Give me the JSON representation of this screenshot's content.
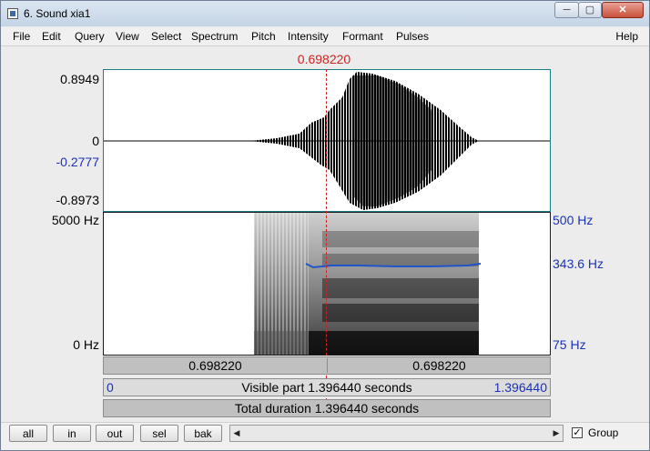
{
  "window": {
    "title": "6. Sound xia1"
  },
  "menu": {
    "items": [
      "File",
      "Edit",
      "Query",
      "View",
      "Select",
      "Spectrum",
      "Pitch",
      "Intensity",
      "Formant",
      "Pulses"
    ],
    "help": "Help"
  },
  "cursor": {
    "time_label": "0.698220",
    "time": 0.69822
  },
  "waveform": {
    "y_max": "0.8949",
    "y_zero": "0",
    "y_cursor": "-0.2777",
    "y_min": "-0.8973"
  },
  "spectrogram": {
    "freq_max": "5000 Hz",
    "freq_min": "0 Hz"
  },
  "pitch": {
    "top": "500 Hz",
    "value": "343.6 Hz",
    "bottom": "75 Hz"
  },
  "bars": {
    "left_segment": "0.698220",
    "right_segment": "0.698220",
    "visible_start": "0",
    "visible_text": "Visible part 1.396440 seconds",
    "visible_end": "1.396440",
    "total_text": "Total duration 1.396440 seconds"
  },
  "nav": {
    "all": "all",
    "in": "in",
    "out": "out",
    "sel": "sel",
    "bak": "bak"
  },
  "group": {
    "label": "Group",
    "checked": true
  },
  "colors": {
    "cursor": "#d32222",
    "pitch": "#1f55c9",
    "blue_label": "#1c32b4"
  }
}
